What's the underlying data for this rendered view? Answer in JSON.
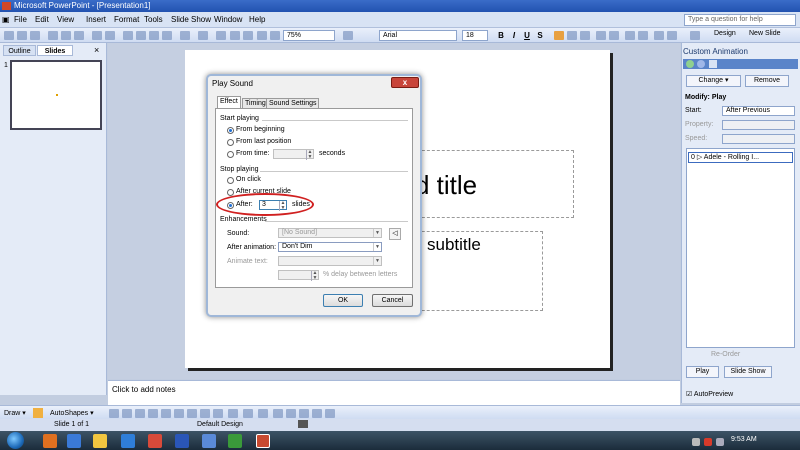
{
  "window": {
    "title": "Microsoft PowerPoint - [Presentation1]"
  },
  "menu": [
    "File",
    "Edit",
    "View",
    "Insert",
    "Format",
    "Tools",
    "Slide Show",
    "Window",
    "Help"
  ],
  "help_placeholder": "Type a question for help",
  "toolbar": {
    "zoom": "75%",
    "font": "Arial",
    "size": "18",
    "bold": "B",
    "italic": "I",
    "underline": "U",
    "shadow": "S",
    "design": "Design",
    "new_slide": "New Slide"
  },
  "left_pane": {
    "tabs": [
      "Outline",
      "Slides"
    ],
    "close": "×",
    "slide_number": "1"
  },
  "slide": {
    "title": "d title",
    "subtitle": "subtitle"
  },
  "notes": "Click to add notes",
  "task_pane": {
    "title": "Custom Animation",
    "change": "Change",
    "remove": "Remove",
    "modify": "Modify: Play",
    "start_label": "Start:",
    "start_value": "After Previous",
    "property_label": "Property:",
    "speed_label": "Speed:",
    "anim_item": "0   ▷ Adele - Rolling I...",
    "reorder": "Re-Order",
    "play": "Play",
    "slideshow": "Slide Show",
    "autopreview": "AutoPreview"
  },
  "dialog": {
    "title": "Play Sound",
    "close": "x",
    "tabs": [
      "Effect",
      "Timing",
      "Sound Settings"
    ],
    "start_group": "Start playing",
    "start_options": [
      "From beginning",
      "From last position",
      "From time:"
    ],
    "seconds": "seconds",
    "stop_group": "Stop playing",
    "stop_options": [
      "On click",
      "After current slide",
      "After:"
    ],
    "after_value": "3",
    "slides": "slides",
    "enh_group": "Enhancements",
    "sound_label": "Sound:",
    "sound_value": "[No Sound]",
    "after_anim_label": "After animation:",
    "after_anim_value": "Don't Dim",
    "animate_text_label": "Animate text:",
    "delay_text": "% delay between letters",
    "ok": "OK",
    "cancel": "Cancel"
  },
  "draw": {
    "draw": "Draw ▾",
    "autoshapes": "AutoShapes ▾"
  },
  "status": {
    "slide": "Slide 1 of 1",
    "design": "Default Design"
  },
  "taskbar": {
    "clock": "9:53 AM"
  }
}
